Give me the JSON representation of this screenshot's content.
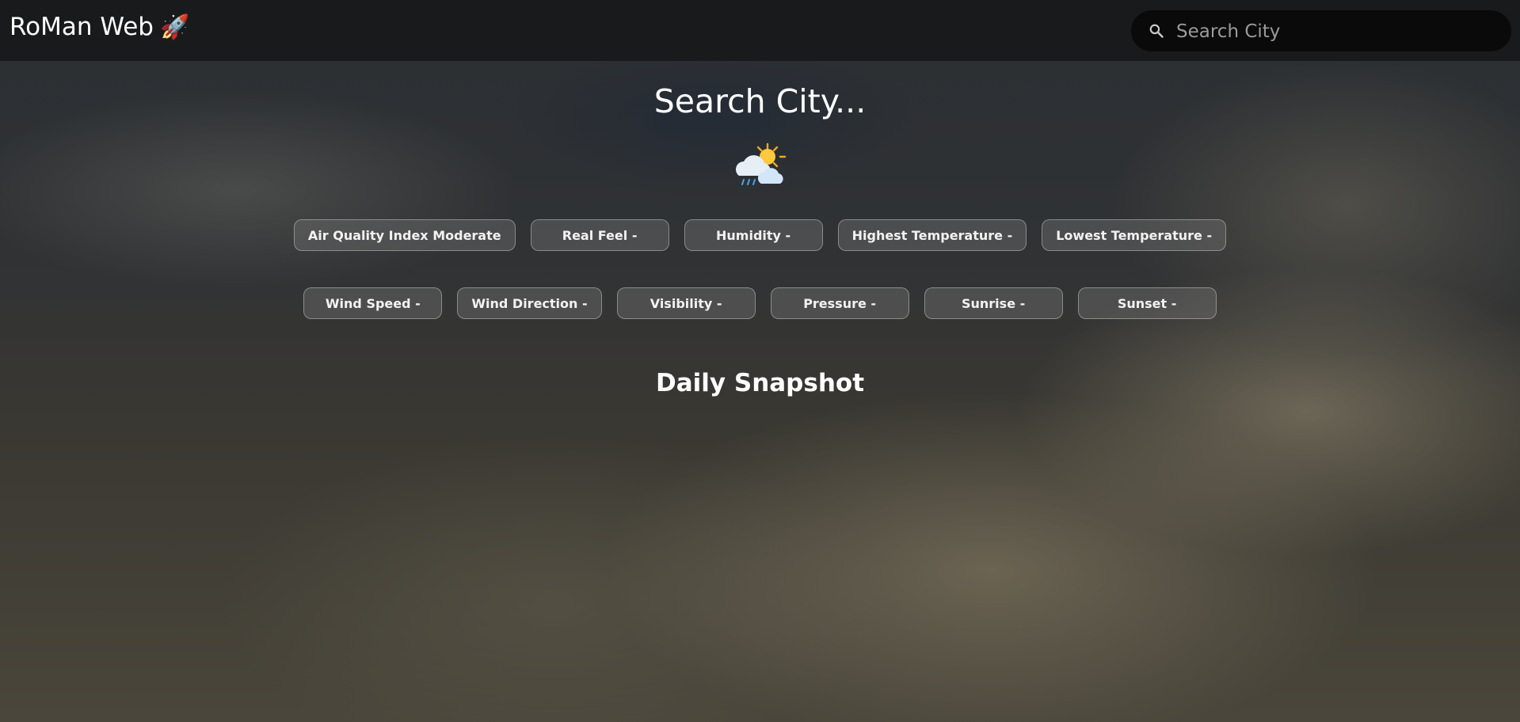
{
  "navbar": {
    "brand": "RoMan Web",
    "brand_emoji": "🚀",
    "search": {
      "placeholder": "Search City",
      "value": ""
    }
  },
  "main": {
    "title": "Search City...",
    "weather_icon": "sun-behind-rain-cloud-icon",
    "metrics_row1": [
      "Air Quality Index Moderate",
      "Real Feel -",
      "Humidity -",
      "Highest Temperature -",
      "Lowest Temperature -"
    ],
    "metrics_row2": [
      "Wind Speed -",
      "Wind Direction -",
      "Visibility -",
      "Pressure -",
      "Sunrise -",
      "Sunset -"
    ],
    "section_title": "Daily Snapshot"
  },
  "colors": {
    "navbar_bg": "#141414",
    "search_bg": "#080808",
    "text": "#ffffff"
  }
}
